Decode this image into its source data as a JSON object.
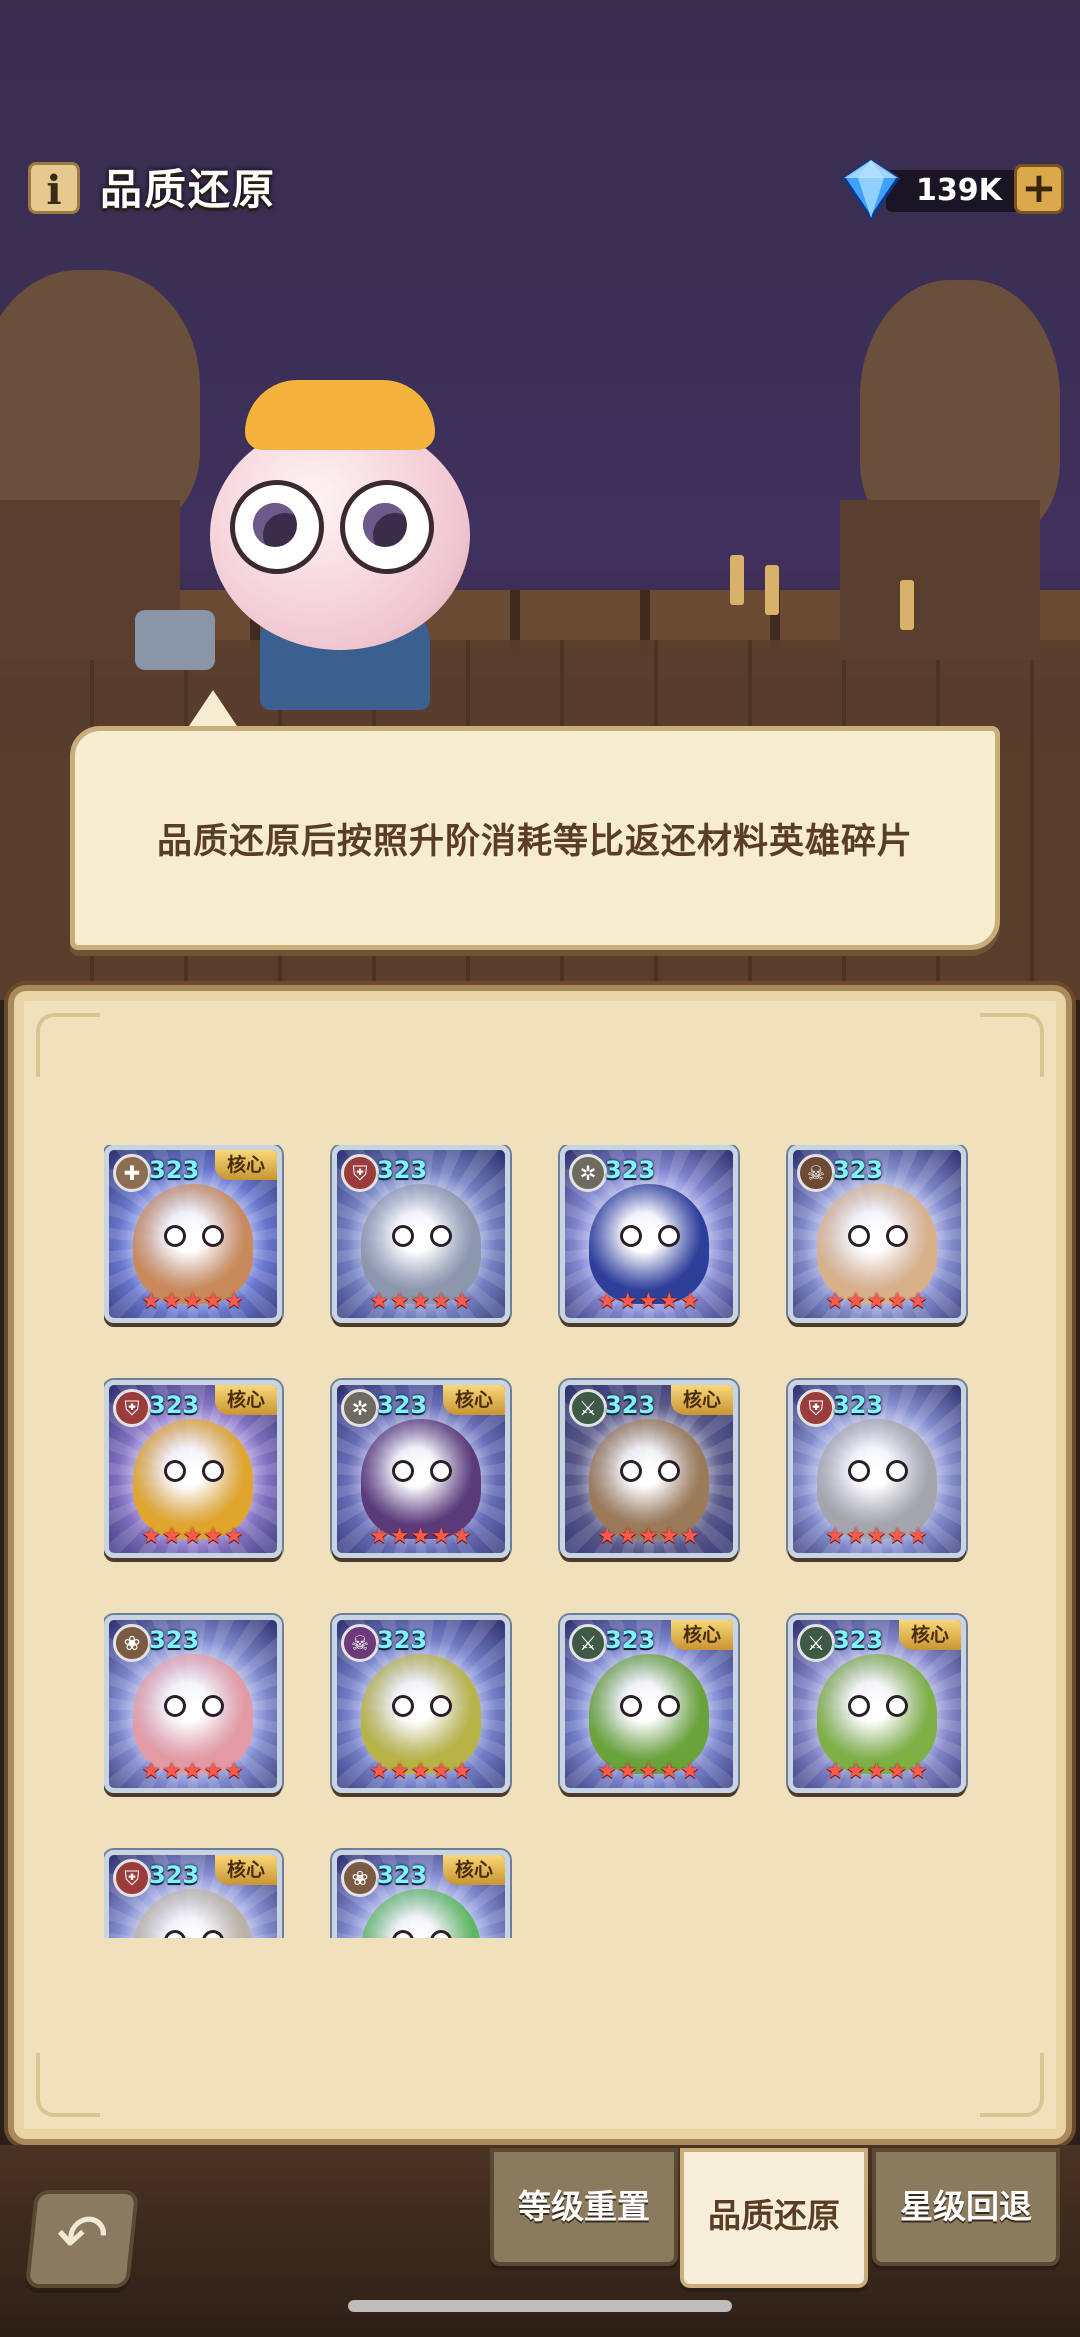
{
  "header": {
    "title": "品质还原",
    "info_icon": "i",
    "currency_value": "139K",
    "plus_label": "+"
  },
  "bubble": {
    "text": "品质还原后按照升阶消耗等比返还材料英雄碎片"
  },
  "heroes": [
    {
      "level": "323",
      "core": "核心",
      "stars": "★★★★★",
      "role_icon": "axe-icon",
      "role_glyph": "✚",
      "role_color": "#8c6d52",
      "portrait_color": "#c98a5b",
      "burst_color": "#6f7fd6"
    },
    {
      "level": "323",
      "core": "",
      "stars": "★★★★★",
      "role_icon": "shield-icon",
      "role_glyph": "⛨",
      "role_color": "#9b3b3b",
      "portrait_color": "#8c97ad",
      "burst_color": "#7a88c9"
    },
    {
      "level": "323",
      "core": "",
      "stars": "★★★★★",
      "role_icon": "tree-icon",
      "role_glyph": "✲",
      "role_color": "#6f6a60",
      "portrait_color": "#2e3f9a",
      "burst_color": "#8a8fd8"
    },
    {
      "level": "323",
      "core": "",
      "stars": "★★★★★",
      "role_icon": "skull-icon",
      "role_glyph": "☠",
      "role_color": "#6d4a36",
      "portrait_color": "#d8b08a",
      "burst_color": "#8b95d4"
    },
    {
      "level": "323",
      "core": "核心",
      "stars": "★★★★★",
      "role_icon": "shield-icon",
      "role_glyph": "⛨",
      "role_color": "#9b3b3b",
      "portrait_color": "#e0a52c",
      "burst_color": "#8b78c9"
    },
    {
      "level": "323",
      "core": "核心",
      "stars": "★★★★★",
      "role_icon": "tree-icon",
      "role_glyph": "✲",
      "role_color": "#6f6a60",
      "portrait_color": "#5b3a7a",
      "burst_color": "#6d73bd"
    },
    {
      "level": "323",
      "core": "核心",
      "stars": "★★★★★",
      "role_icon": "swords-icon",
      "role_glyph": "⚔",
      "role_color": "#3e5a46",
      "portrait_color": "#9a7a58",
      "burst_color": "#5c5c8c"
    },
    {
      "level": "323",
      "core": "",
      "stars": "★★★★★",
      "role_icon": "shield-icon",
      "role_glyph": "⛨",
      "role_color": "#9b3b3b",
      "portrait_color": "#a5a5ad",
      "burst_color": "#8e98d6"
    },
    {
      "level": "323",
      "core": "",
      "stars": "★★★★★",
      "role_icon": "paw-icon",
      "role_glyph": "❀",
      "role_color": "#7a5a42",
      "portrait_color": "#e39aa4",
      "burst_color": "#8a94d8"
    },
    {
      "level": "323",
      "core": "",
      "stars": "★★★★★",
      "role_icon": "skull-icon",
      "role_glyph": "☠",
      "role_color": "#6d3a7a",
      "portrait_color": "#b8b346",
      "burst_color": "#7a86cf"
    },
    {
      "level": "323",
      "core": "核心",
      "stars": "★★★★★",
      "role_icon": "swords-icon",
      "role_glyph": "⚔",
      "role_color": "#3e5a46",
      "portrait_color": "#6aa33a",
      "burst_color": "#7f8ad2"
    },
    {
      "level": "323",
      "core": "核心",
      "stars": "★★★★★",
      "role_icon": "swords-icon",
      "role_glyph": "⚔",
      "role_color": "#3e5a46",
      "portrait_color": "#7fb045",
      "burst_color": "#8a8ecf"
    },
    {
      "level": "323",
      "core": "核心",
      "stars": "★★★★★",
      "role_icon": "shield-icon",
      "role_glyph": "⛨",
      "role_color": "#9b3b3b",
      "portrait_color": "#b9b1a3",
      "burst_color": "#8f99d8"
    },
    {
      "level": "323",
      "core": "核心",
      "stars": "★★★★★",
      "role_icon": "paw-icon",
      "role_glyph": "❀",
      "role_color": "#7a5a42",
      "portrait_color": "#5fb860",
      "burst_color": "#8a94d8"
    }
  ],
  "tabs": [
    {
      "label": "等级重置",
      "active": false
    },
    {
      "label": "品质还原",
      "active": true
    },
    {
      "label": "星级回退",
      "active": false
    }
  ],
  "back_glyph": "↶"
}
